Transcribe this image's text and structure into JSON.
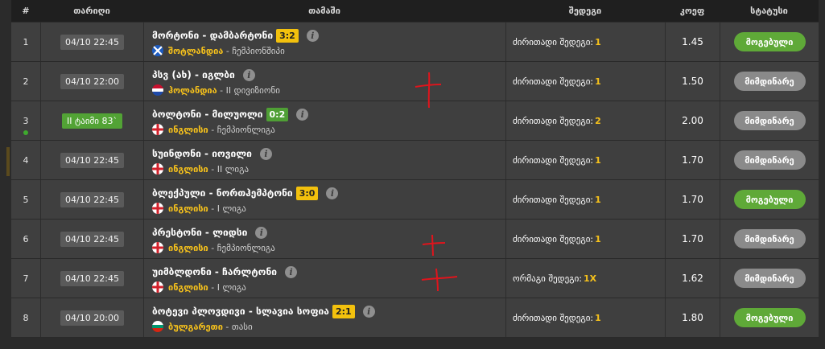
{
  "columns": {
    "num": "#",
    "date": "თარიღი",
    "match": "თამაში",
    "result": "შედეგი",
    "odds": "კოეფ",
    "status": "სტატუსი"
  },
  "rows": [
    {
      "num": "1",
      "time": "04/10 22:45",
      "live": false,
      "match": "მორტონი - დამბარტონი",
      "score": "3:2",
      "score_color": "yellow",
      "flag": "scotland",
      "country": "შოტლანდია",
      "league": "ჩემპიონშიპი",
      "result_label": "ძირითადი შედეგი:",
      "result_value": "1",
      "odds": "1.45",
      "status": "მოგებული",
      "status_type": "won"
    },
    {
      "num": "2",
      "time": "04/10 22:00",
      "live": false,
      "match": "პსვ (ახ) - იგლბი",
      "score": "",
      "score_color": "",
      "flag": "netherlands",
      "country": "ჰოლანდია",
      "league": "II დივიზიონი",
      "result_label": "ძირითადი შედეგი:",
      "result_value": "1",
      "odds": "1.50",
      "status": "მიმდინარე",
      "status_type": "current"
    },
    {
      "num": "3",
      "time": "II ტაიმი 83`",
      "live": true,
      "match": "ბოლტონი - მილუოლი",
      "score": "0:2",
      "score_color": "green",
      "flag": "england",
      "country": "ინგლისი",
      "league": "ჩემპიონლიგა",
      "result_label": "ძირითადი შედეგი:",
      "result_value": "2",
      "odds": "2.00",
      "status": "მიმდინარე",
      "status_type": "current"
    },
    {
      "num": "4",
      "time": "04/10 22:45",
      "live": false,
      "match": "სუინდონი - იოვილი",
      "score": "",
      "score_color": "",
      "flag": "england",
      "country": "ინგლისი",
      "league": "II ლიგა",
      "result_label": "ძირითადი შედეგი:",
      "result_value": "1",
      "odds": "1.70",
      "status": "მიმდინარე",
      "status_type": "current"
    },
    {
      "num": "5",
      "time": "04/10 22:45",
      "live": false,
      "match": "ბლექპული - ნორთჰემპტონი",
      "score": "3:0",
      "score_color": "yellow",
      "flag": "england",
      "country": "ინგლისი",
      "league": "I ლიგა",
      "result_label": "ძირითადი შედეგი:",
      "result_value": "1",
      "odds": "1.70",
      "status": "მოგებული",
      "status_type": "won"
    },
    {
      "num": "6",
      "time": "04/10 22:45",
      "live": false,
      "match": "პრესტონი - ლიდსი",
      "score": "",
      "score_color": "",
      "flag": "england",
      "country": "ინგლისი",
      "league": "ჩემპიონლიგა",
      "result_label": "ძირითადი შედეგი:",
      "result_value": "1",
      "odds": "1.70",
      "status": "მიმდინარე",
      "status_type": "current"
    },
    {
      "num": "7",
      "time": "04/10 22:45",
      "live": false,
      "match": "უიმბლდონი - ჩარლტონი",
      "score": "",
      "score_color": "",
      "flag": "england",
      "country": "ინგლისი",
      "league": "I ლიგა",
      "result_label": "ორმაგი შედეგი:",
      "result_value": "1X",
      "odds": "1.62",
      "status": "მიმდინარე",
      "status_type": "current"
    },
    {
      "num": "8",
      "time": "04/10 20:00",
      "live": false,
      "match": "ბოტევი პლოვდივი - სლავია სოფია",
      "score": "2:1",
      "score_color": "yellow",
      "flag": "bulgaria",
      "country": "ბულგარეთი",
      "league": "თასი",
      "result_label": "ძირითადი შედეგი:",
      "result_value": "1",
      "odds": "1.80",
      "status": "მოგებული",
      "status_type": "won"
    }
  ],
  "colors": {
    "won": "#5fa938",
    "current": "#8a8a8a",
    "accent": "#f7c21b",
    "row_bg": "#3f3f3f",
    "header_bg": "#1f1f1f",
    "hand_mark": "#e0141c"
  },
  "icons": {
    "info": "info-icon",
    "live": "live-dot-icon"
  }
}
